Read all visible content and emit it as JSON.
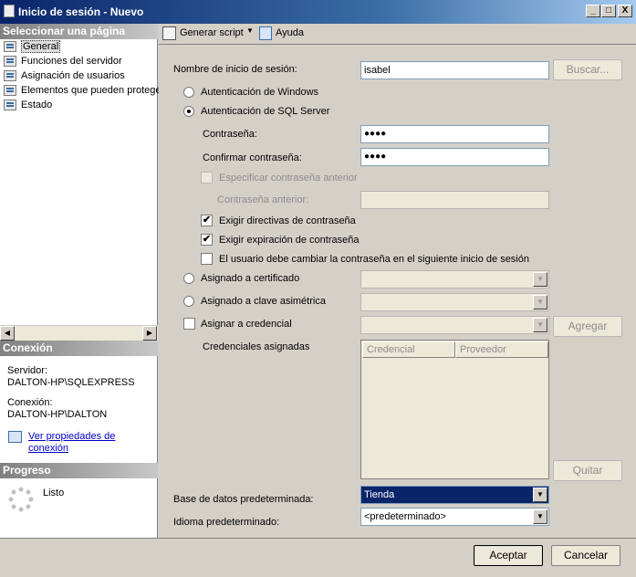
{
  "window": {
    "title": "Inicio de sesión - Nuevo",
    "controls": [
      "_",
      "□",
      "X"
    ]
  },
  "left_pane": {
    "select_page_header": "Seleccionar una página",
    "pages": [
      {
        "label": "General",
        "selected": true
      },
      {
        "label": "Funciones del servidor",
        "selected": false
      },
      {
        "label": "Asignación de usuarios",
        "selected": false
      },
      {
        "label": "Elementos que pueden protege",
        "selected": false
      },
      {
        "label": "Estado",
        "selected": false
      }
    ],
    "connection_header": "Conexión",
    "server_label": "Servidor:",
    "server_value": "DALTON-HP\\SQLEXPRESS",
    "connection_label": "Conexión:",
    "connection_value": "DALTON-HP\\DALTON",
    "view_properties_link_line1": "Ver propiedades de",
    "view_properties_link_line2": "conexión",
    "progress_header": "Progreso",
    "progress_status": "Listo"
  },
  "toolbar": {
    "generate_script": "Generar script",
    "help": "Ayuda"
  },
  "form": {
    "login_name_label": "Nombre de inicio de sesión:",
    "login_name_value": "isabel",
    "search_button": "Buscar...",
    "windows_auth": "Autenticación de Windows",
    "sql_auth": "Autenticación de SQL Server",
    "password_label": "Contraseña:",
    "password_value": "●●●●",
    "confirm_password_label": "Confirmar contraseña:",
    "confirm_password_value": "●●●●",
    "specify_old_password": "Especificar contraseña anterior",
    "old_password_label": "Contraseña anterior:",
    "enforce_policy": "Exigir directivas de contraseña",
    "enforce_expiration": "Exigir expiración de contraseña",
    "must_change": "El usuario debe cambiar la contraseña en el siguiente inicio de sesión",
    "mapped_certificate": "Asignado a certificado",
    "mapped_asymmetric_key": "Asignado a clave asimétrica",
    "map_credential": "Asignar a credencial",
    "add_button": "Agregar",
    "mapped_credentials_label": "Credenciales asignadas",
    "grid_columns": [
      "Credencial",
      "Proveedor"
    ],
    "remove_button": "Quitar",
    "default_database_label": "Base de datos predeterminada:",
    "default_database_value": "Tienda",
    "default_language_label": "Idioma predeterminado:",
    "default_language_value": "<predeterminado>"
  },
  "footer": {
    "ok": "Aceptar",
    "cancel": "Cancelar"
  },
  "colors": {
    "title_bar": "#0a246a",
    "dialog_bg": "#d4d0c8",
    "selection": "#0a246a",
    "link": "#0000cc"
  }
}
